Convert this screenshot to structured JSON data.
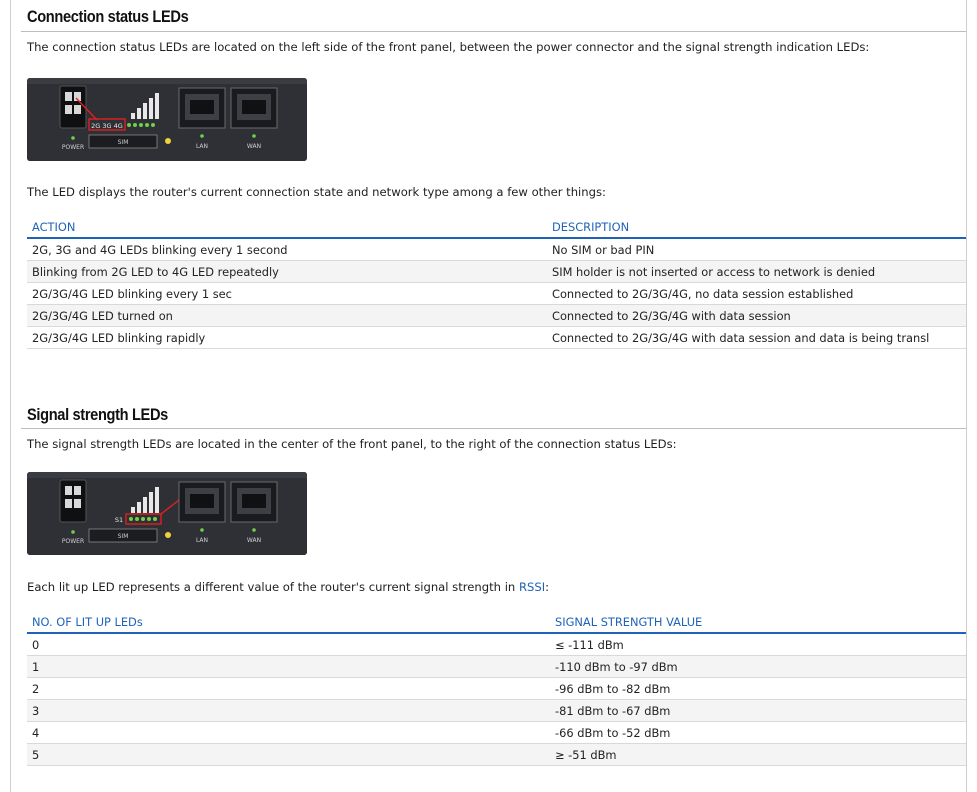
{
  "section1": {
    "heading": "Connection status LEDs",
    "intro": "The connection status LEDs are located on the left side of the front panel, between the power connector and the signal strength indication LEDs:",
    "device_labels": {
      "power": "POWER",
      "sim": "SIM",
      "lan": "LAN",
      "wan": "WAN",
      "led_tag": "2G 3G 4G"
    },
    "caption": "The LED displays the router's current connection state and network type among a few other things:",
    "table": {
      "headers": [
        "ACTION",
        "DESCRIPTION"
      ],
      "rows": [
        [
          "2G, 3G and 4G LEDs blinking every 1 second",
          "No SIM or bad PIN"
        ],
        [
          "Blinking from 2G LED to 4G LED repeatedly",
          "SIM holder is not inserted or access to network is denied"
        ],
        [
          "2G/3G/4G LED blinking every 1 sec",
          "Connected to 2G/3G/4G, no data session established"
        ],
        [
          "2G/3G/4G LED turned on",
          "Connected to 2G/3G/4G with data session"
        ],
        [
          "2G/3G/4G LED blinking rapidly",
          "Connected to 2G/3G/4G with data session and data is being transl"
        ]
      ]
    }
  },
  "section2": {
    "heading": "Signal strength LEDs",
    "intro": "The signal strength LEDs are located in the center of the front panel, to the right of the connection status LEDs:",
    "device_labels": {
      "power": "POWER",
      "sim": "SIM",
      "lan": "LAN",
      "wan": "WAN",
      "led_tag": "S1"
    },
    "caption_prefix": "Each lit up LED represents a different value of the router's current signal strength in ",
    "caption_link": "RSSI",
    "caption_suffix": ":",
    "table": {
      "headers": [
        "NO. OF LIT UP LEDs",
        "SIGNAL STRENGTH VALUE"
      ],
      "rows": [
        [
          "0",
          "≤ -111 dBm"
        ],
        [
          "1",
          "-110 dBm to -97 dBm"
        ],
        [
          "2",
          "-96 dBm to -82 dBm"
        ],
        [
          "3",
          "-81 dBm to -67 dBm"
        ],
        [
          "4",
          "-66 dBm to -52 dBm"
        ],
        [
          "5",
          "≥ -51 dBm"
        ]
      ]
    }
  },
  "colors": {
    "accent": "#1f63b8",
    "highlight": "#e02020",
    "led_green": "#6fd04a",
    "led_yellow": "#f2d23a"
  }
}
